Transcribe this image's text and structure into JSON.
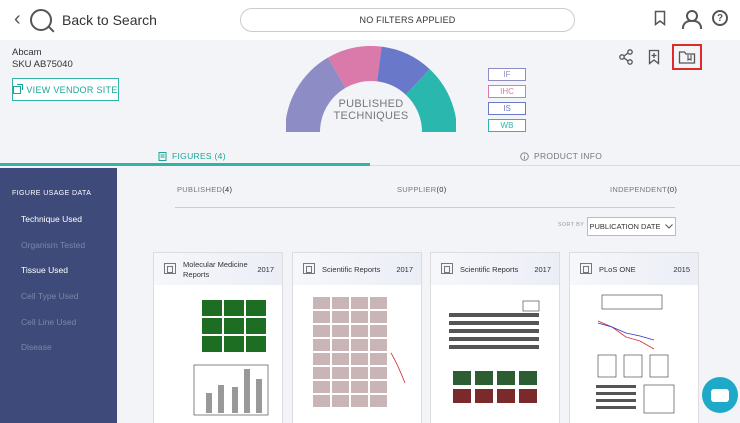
{
  "topbar": {
    "back_label": "Back to Search",
    "filters_label": "NO FILTERS APPLIED",
    "icons": [
      "bookmark-icon",
      "user-icon",
      "help-icon"
    ],
    "help_glyph": "?"
  },
  "product": {
    "vendor": "Abcam",
    "sku": "SKU AB75040",
    "vendor_button": "VIEW VENDOR SITE"
  },
  "techniques": {
    "title_line1": "PUBLISHED",
    "title_line2": "TECHNIQUES",
    "segments": [
      {
        "label": "IF",
        "color": "#8d8cc4"
      },
      {
        "label": "IHC",
        "color": "#d97aaa"
      },
      {
        "label": "IS",
        "color": "#6a78c9"
      },
      {
        "label": "WB",
        "color": "#2ab7ae"
      }
    ]
  },
  "tabs": {
    "figures": "FIGURES (4)",
    "product_info": "PRODUCT INFO"
  },
  "sidebar": {
    "heading": "FIGURE USAGE DATA",
    "items": [
      {
        "label": "Technique Used",
        "active": true
      },
      {
        "label": "Organism Tested",
        "active": false
      },
      {
        "label": "Tissue Used",
        "active": true
      },
      {
        "label": "Cell Type Used",
        "active": false
      },
      {
        "label": "Cell Line Used",
        "active": false
      },
      {
        "label": "Disease",
        "active": false
      }
    ]
  },
  "subtabs": {
    "published_label": "PUBLISHED",
    "published_count": "(4)",
    "supplier_label": "SUPPLIER",
    "supplier_count": "(0)",
    "independent_label": "INDEPENDENT",
    "independent_count": "(0)"
  },
  "sort": {
    "label": "SORT BY",
    "value": "PUBLICATION DATE"
  },
  "cards": [
    {
      "journal": "Molecular Medicine Reports",
      "year": "2017"
    },
    {
      "journal": "Scientific Reports",
      "year": "2017"
    },
    {
      "journal": "Scientific Reports",
      "year": "2017"
    },
    {
      "journal": "PLoS ONE",
      "year": "2015"
    }
  ]
}
